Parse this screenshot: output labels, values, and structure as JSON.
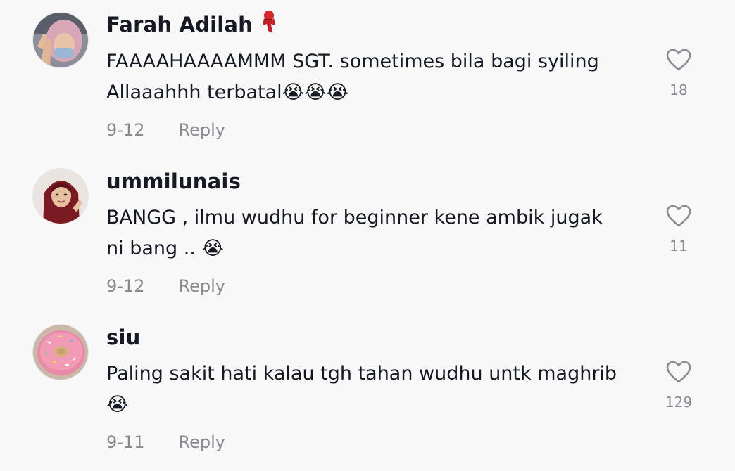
{
  "comments": [
    {
      "username": "Farah Adilah",
      "badge_icon": "red-scarf-emoji",
      "text": "FAAAAHAAAAMMM SGT. sometimes bila bagi syiling\nAllaaahhh terbatal😭😭😭",
      "date": "9-12",
      "reply_label": "Reply",
      "likes": "18"
    },
    {
      "username": "ummilunais",
      "text": "BANGG , ilmu wudhu for beginner kene ambik jugak\nni bang .. 😭",
      "date": "9-12",
      "reply_label": "Reply",
      "likes": "11"
    },
    {
      "username": "siu",
      "text": "Paling sakit hati kalau tgh tahan wudhu untk maghrib\n😭",
      "date": "9-11",
      "reply_label": "Reply",
      "likes": "129"
    }
  ],
  "colors": {
    "background": "#f8f8f8",
    "username": "#161823",
    "secondary": "#8a8b91"
  }
}
